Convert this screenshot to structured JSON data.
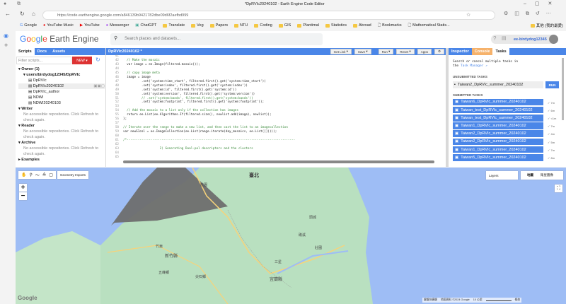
{
  "browser": {
    "title": "*DpRVIc20240102 - Earth Engine Code Editor",
    "url": "https://code.earthengine.google.com/a846139b9421782dbe09d6f2aefbd999",
    "bookmarks": [
      "Google",
      "YouTube Music",
      "YouTube",
      "Messenger",
      "ChatGPT",
      "Translate",
      "Veg",
      "Papers",
      "NTU",
      "Coding",
      "GIS",
      "Plantimal",
      "Statistics",
      "Abroad",
      "Bookmarks",
      "Mathematical Statis..."
    ],
    "other_bookmarks": "其他 (我的最愛)"
  },
  "header": {
    "logo": "Google Earth Engine",
    "search_placeholder": "Search places and datasets...",
    "user": "ee-birdydog12345"
  },
  "left_panel": {
    "tabs": [
      "Scripts",
      "Docs",
      "Assets"
    ],
    "filter_placeholder": "Filter scripts...",
    "new_label": "NEW",
    "owner": "Owner (1)",
    "repo": "users/birdydog12345/DpRVIc",
    "files": [
      "DpRVIc",
      "DpRVIc20240102",
      "DpRVIc_author",
      "NDWI",
      "NDWI20240103"
    ],
    "sections": [
      {
        "title": "Writer",
        "msg": "No accessible repositories. Click Refresh to check again."
      },
      {
        "title": "Reader",
        "msg": "No accessible repositories. Click Refresh to check again."
      },
      {
        "title": "Archive",
        "msg": "No accessible repositories. Click Refresh to check again."
      }
    ],
    "examples": "Examples"
  },
  "editor": {
    "title": "DpRVIc20240102 *",
    "buttons": [
      "Get Link",
      "Save",
      "Run",
      "Reset",
      "Apps"
    ],
    "lines": [
      {
        "n": "41",
        "t": ""
      },
      {
        "n": "42",
        "t": "  // Make the mosaic"
      },
      {
        "n": "43",
        "t": "  var image = ee.Image(filtered.mosaic());"
      },
      {
        "n": "44",
        "t": ""
      },
      {
        "n": "45",
        "t": "  // copy image meta"
      },
      {
        "n": "46",
        "t": "  image = image"
      },
      {
        "n": "47",
        "t": "          .set('system:time_start', filtered.first().get('system:time_start'))"
      },
      {
        "n": "48",
        "t": "          .set('system:index', filtered.first().get('system:index'))"
      },
      {
        "n": "49",
        "t": "          .set('system:id', filtered.first().get('system:id'))"
      },
      {
        "n": "50",
        "t": "          .set('system:version', filtered.first().get('system:version'))"
      },
      {
        "n": "51",
        "t": "          // .set('system:bands', filtered.first().get('system:bands'))"
      },
      {
        "n": "52",
        "t": "          .set('system:footprint', filtered.first().get('system:footprint'));"
      },
      {
        "n": "53",
        "t": ""
      },
      {
        "n": "54",
        "t": "  // Add the mosaic to a list only if the collection has images"
      },
      {
        "n": "55",
        "t": "  return ee.List(ee.Algorithms.If(filtered.size(), newlist.add(image), newlist));"
      },
      {
        "n": "56",
        "t": "};"
      },
      {
        "n": "57",
        "t": ""
      },
      {
        "n": "58",
        "t": "// Iterate over the range to make a new list, and then cast the list to an imagecollection"
      },
      {
        "n": "59",
        "t": "var newS1col = ee.ImageCollection(ee.List(range.iterate(day_mosaics, ee.List([]))));"
      },
      {
        "n": "60",
        "t": ""
      },
      {
        "n": "61",
        "t": "/*--------------------------------------------------------------------------------------------"
      },
      {
        "n": "62",
        "t": ""
      },
      {
        "n": "63",
        "t": "                    2) Generating Dual-pol descriptors and the clusters"
      },
      {
        "n": "64",
        "t": ""
      },
      {
        "n": "65",
        "t": ""
      }
    ]
  },
  "right_panel": {
    "tabs": [
      "Inspector",
      "Console",
      "Tasks"
    ],
    "intro": "Search or cancel multiple tasks in",
    "intro2": "the",
    "link": "Task Manager",
    "unsubmitted_title": "UNSUBMITTED TASKS",
    "unsubmitted": "Taiwan2_DpRVIc_summer_20240102",
    "run_label": "RUN",
    "submitted_title": "SUBMITTED TASKS",
    "submitted": [
      {
        "name": "Taiwan6_DpRVIc_summer_20240102",
        "time": "7m"
      },
      {
        "name": "Taiwan_test_DpRVIc_summer_20240102",
        "time": "6m"
      },
      {
        "name": "Taiwan_test_DpRVIc_summer_20240102",
        "time": "<1m"
      },
      {
        "name": "Taiwan1_DpRVIc_summer_20240102",
        "time": "7m"
      },
      {
        "name": "Taiwan2_DpRVIc_summer_20240102",
        "time": "4m"
      },
      {
        "name": "Taiwan2_DpRVIc_summer_20240102",
        "time": "5m"
      },
      {
        "name": "Taiwan1_DpRVIc_summer_20240102",
        "time": "7m"
      },
      {
        "name": "Taiwan5_DpRVIc_summer_20240102",
        "time": "8m"
      }
    ]
  },
  "map": {
    "geometry_imports": "Geometry Imports",
    "layers": "Layers",
    "map_type": "地圖",
    "satellite": "衛星圖像",
    "labels": [
      "臺北",
      "桃園",
      "新竹縣",
      "宜蘭縣",
      "三星",
      "礁溪",
      "頭城",
      "壯圍",
      "五峰鄉",
      "尖石鄉",
      "竹東"
    ],
    "footer": {
      "shortcuts": "鍵盤快捷鍵",
      "data": "地圖資料 ©2024 Google",
      "scale": "10 公里",
      "terms": "條款"
    },
    "logo": "Google"
  }
}
